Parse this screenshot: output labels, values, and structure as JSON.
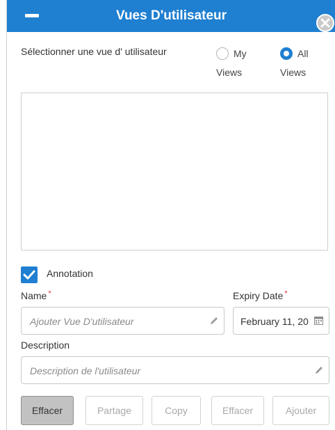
{
  "dialog": {
    "title": "Vues D'utilisateur"
  },
  "view_select": {
    "label": "Sélectionner une vue d' utilisateur",
    "options": [
      {
        "word1": "My",
        "word2": "Views",
        "selected": false
      },
      {
        "word1": "All",
        "word2": "Views",
        "selected": true
      }
    ]
  },
  "annotation": {
    "label": "Annotation",
    "checked": true
  },
  "fields": {
    "name_label": "Name",
    "name_placeholder": "Ajouter Vue D'utilisateur",
    "expiry_label": "Expiry Date",
    "expiry_value": "February 11, 20",
    "description_label": "Description",
    "description_placeholder": "Description de l'utilisateur",
    "required_mark": "*"
  },
  "buttons": {
    "clear_primary": "Effacer",
    "share": "Partage",
    "copy": "Copy",
    "clear": "Effacer",
    "add": "Ajouter"
  },
  "colors": {
    "accent": "#1f7fd1",
    "required": "#e03030"
  },
  "icons": {
    "minimize": "minimize-icon",
    "close": "close-icon",
    "check": "check-icon",
    "pencil": "pencil-icon",
    "calendar": "calendar-icon"
  }
}
